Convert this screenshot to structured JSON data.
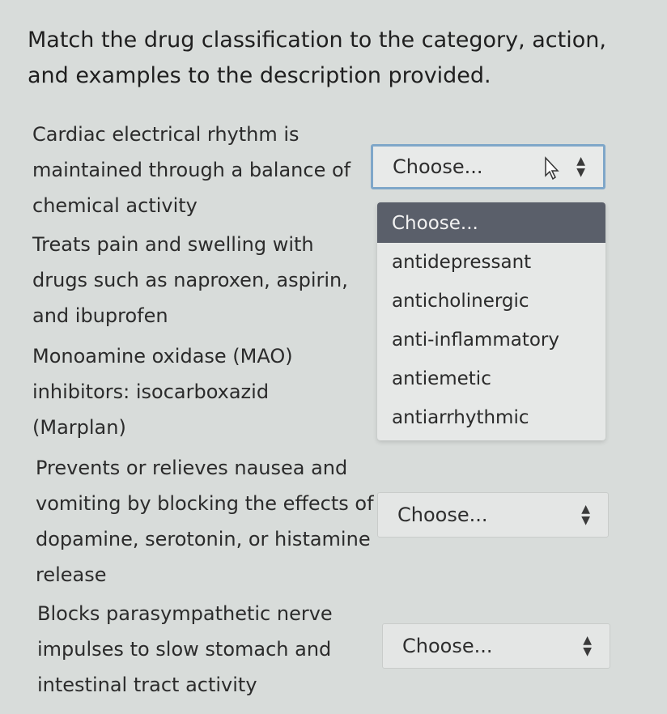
{
  "question": "Match the drug classification to the category, action, and examples to the description provided.",
  "items": [
    {
      "description": "Cardiac electrical rhythm is maintained through a balance of chemical activity",
      "select_value": "Choose..."
    },
    {
      "description": "Treats pain and swelling with drugs such as naproxen, aspirin, and ibuprofen"
    },
    {
      "description": "Monoamine oxidase (MAO) inhibitors: isocarboxazid (Marplan)"
    },
    {
      "description": "Prevents or relieves nausea and vomiting by blocking the effects of dopamine, serotonin, or histamine release",
      "select_value": "Choose..."
    },
    {
      "description": "Blocks parasympathetic nerve impulses to slow stomach and intestinal tract activity",
      "select_value": "Choose..."
    }
  ],
  "dropdown": {
    "options": [
      "Choose...",
      "antidepressant",
      "anticholinergic",
      "anti-inflammatory",
      "antiemetic",
      "antiarrhythmic"
    ],
    "selected_index": 0
  },
  "icons": {
    "select_arrows": "up-down-arrows-icon",
    "cursor": "mouse-pointer-icon"
  }
}
